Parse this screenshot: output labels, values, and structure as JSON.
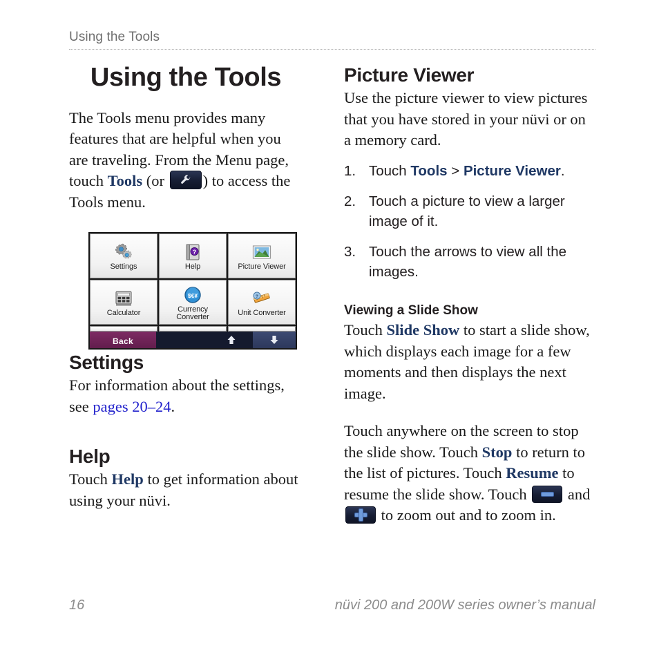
{
  "header": {
    "running_head": "Using the Tools"
  },
  "left_column": {
    "chapter_title": "Using the Tools",
    "intro": {
      "part1": "The Tools menu provides many features that are helpful when you are traveling. From the Menu page, touch ",
      "bold_tools": "Tools",
      "part2": " (or ",
      "part3": ") to access the Tools menu."
    },
    "settings": {
      "heading": "Settings",
      "text_before": "For information about the settings, see ",
      "link": "pages 20–24",
      "text_after": "."
    },
    "help": {
      "heading": "Help",
      "text_before": "Touch ",
      "bold_help": "Help",
      "text_after": " to get information about using your nüvi."
    }
  },
  "device_screenshot": {
    "alt": "nuvi Tools menu screen",
    "tools": [
      {
        "label": "Settings",
        "icon": "gears-icon"
      },
      {
        "label": "Help",
        "icon": "help-book-icon"
      },
      {
        "label": "Picture Viewer",
        "icon": "photo-icon"
      },
      {
        "label": "Calculator",
        "icon": "calculator-icon"
      },
      {
        "label": "Currency\nConverter",
        "icon": "currency-circle-icon"
      },
      {
        "label": "Unit Converter",
        "icon": "unit-converter-icon"
      }
    ],
    "tool_labels": {
      "settings": "Settings",
      "help": "Help",
      "picture_viewer": "Picture Viewer",
      "calculator": "Calculator",
      "currency_converter_line1": "Currency",
      "currency_converter_line2": "Converter",
      "unit_converter": "Unit Converter"
    },
    "statusbar": {
      "back_label": "Back",
      "scroll_up": "up-arrow-icon",
      "scroll_down": "down-arrow-icon"
    },
    "colors": {
      "back_button": "#5e1b49",
      "statusbar_bg": "#141a2e",
      "down_button": "#2a3558"
    }
  },
  "right_column": {
    "picture_viewer": {
      "heading": "Picture Viewer",
      "intro": "Use the picture viewer to view pictures that you have stored in your nüvi or on a memory card."
    },
    "steps": [
      {
        "num": "1.",
        "before": "Touch ",
        "bold_a": "Tools",
        "middle": " > ",
        "bold_b": "Picture Viewer",
        "after": "."
      },
      {
        "num": "2.",
        "before": "Touch a picture to view a larger image of it.",
        "bold_a": "",
        "middle": "",
        "bold_b": "",
        "after": ""
      },
      {
        "num": "3.",
        "before": "Touch the arrows to view all the images.",
        "bold_a": "",
        "middle": "",
        "bold_b": "",
        "after": ""
      }
    ],
    "slide_show": {
      "heading": "Viewing a Slide Show",
      "p1_before": "Touch ",
      "p1_bold": "Slide Show",
      "p1_after": " to start a slide show, which displays each image for a few moments and then displays the next image.",
      "p2_a": "Touch anywhere on the screen to stop the slide show. Touch ",
      "p2_bold1": "Stop",
      "p2_b": " to return to the list of pictures. Touch ",
      "p2_bold2": "Resume",
      "p2_c": " to resume the slide show. Touch ",
      "p2_d": " and ",
      "p2_e": " to zoom out and to zoom in."
    }
  },
  "footer": {
    "page_number": "16",
    "manual_title": "nüvi 200 and 200W series owner’s manual"
  },
  "colors": {
    "accent_blue": "#1f3864",
    "link_blue": "#2222cc",
    "body_text": "#1a1a1a",
    "muted_gray": "#8c8c8c"
  }
}
